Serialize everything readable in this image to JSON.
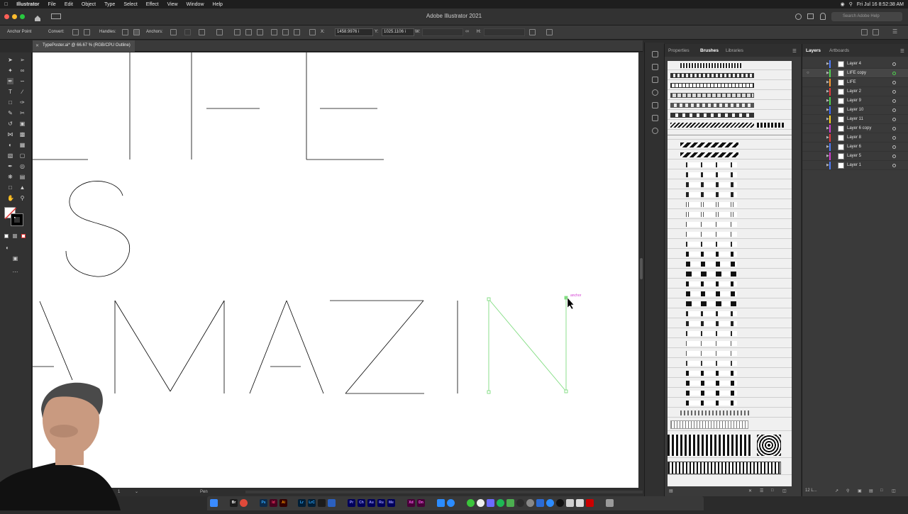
{
  "menubar": {
    "app": "Illustrator",
    "items": [
      "File",
      "Edit",
      "Object",
      "Type",
      "Select",
      "Effect",
      "View",
      "Window",
      "Help"
    ],
    "clock": "Fri Jul 16  8:52:38 AM"
  },
  "titlebar": {
    "title": "Adobe Illustrator 2021",
    "search_placeholder": "Search Adobe Help"
  },
  "controlbar": {
    "tool_name": "Anchor Point",
    "convert_label": "Convert:",
    "handles_label": "Handles:",
    "anchors_label": "Anchors:",
    "x_label": "X:",
    "x_value": "1458.9976 i",
    "y_label": "Y:",
    "y_value": "1025.1106 i",
    "w_label": "W:",
    "h_label": "H:"
  },
  "document": {
    "tab_label": "TypePoster.ai* @ 66.67 % (RGB/CPU Outline)",
    "anchor_hint": "anchor"
  },
  "statusbar": {
    "page": "1",
    "tool": "Pen"
  },
  "brushes_panel": {
    "tabs": [
      "Properties",
      "Brushes",
      "Libraries"
    ],
    "active_tab": "Brushes"
  },
  "layers_panel": {
    "tabs": [
      "Layers",
      "Artboards"
    ],
    "active_tab": "Layers",
    "layers": [
      {
        "name": "Layer 4",
        "color": "#4f7cff"
      },
      {
        "name": "LIFE copy",
        "color": "#4fd24f",
        "selected": true
      },
      {
        "name": "LIFE",
        "color": "#ff9a2f"
      },
      {
        "name": "Layer 2",
        "color": "#e83a3a"
      },
      {
        "name": "Layer 9",
        "color": "#4fd24f"
      },
      {
        "name": "Layer 10",
        "color": "#3a6bff"
      },
      {
        "name": "Layer 11",
        "color": "#ffd21f"
      },
      {
        "name": "Layer 6 copy",
        "color": "#d23ad2"
      },
      {
        "name": "Layer 8",
        "color": "#e83a3a"
      },
      {
        "name": "Layer 6",
        "color": "#4f7cff"
      },
      {
        "name": "Layer 5",
        "color": "#d23ad2"
      },
      {
        "name": "Layer 1",
        "color": "#4f7cff"
      }
    ],
    "footer_count": "12 L..."
  },
  "colors": {
    "selection": "#7fdc7f",
    "anchor_hint": "#d23ad2"
  }
}
